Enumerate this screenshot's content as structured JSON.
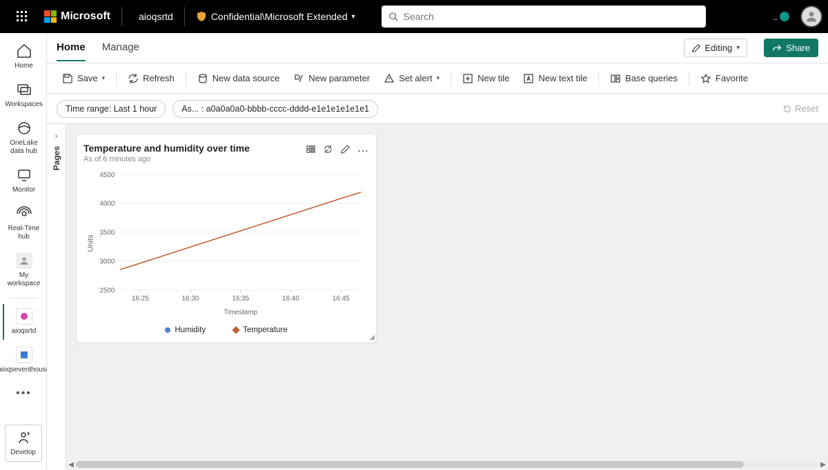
{
  "header": {
    "brand": "Microsoft",
    "tenant": "aioqsrtd",
    "sensitivity_label": "Confidential\\Microsoft Extended",
    "search_placeholder": "Search"
  },
  "leftnav": {
    "home": "Home",
    "workspaces": "Workspaces",
    "onelake": "OneLake data hub",
    "monitor": "Monitor",
    "realtime": "Real-Time hub",
    "myworkspace": "My workspace",
    "item1": "aioqsrtd",
    "item2": "aioqseventhouse",
    "develop": "Develop"
  },
  "tabs": {
    "home": "Home",
    "manage": "Manage",
    "editing": "Editing",
    "share": "Share"
  },
  "toolbar": {
    "save": "Save",
    "refresh": "Refresh",
    "new_data_source": "New data source",
    "new_parameter": "New parameter",
    "set_alert": "Set alert",
    "new_tile": "New tile",
    "new_text_tile": "New text tile",
    "base_queries": "Base queries",
    "favorite": "Favorite"
  },
  "filters": {
    "time_range": "Time range: Last 1 hour",
    "param": "As... : a0a0a0a0-bbbb-cccc-dddd-e1e1e1e1e1e1",
    "reset": "Reset"
  },
  "pages_label": "Pages",
  "tile": {
    "title": "Temperature and humidity over time",
    "subtitle": "As of 6 minutes ago",
    "ylabel": "Units",
    "xlabel": "Timestamp",
    "legend_humidity": "Humidity",
    "legend_temperature": "Temperature"
  },
  "colors": {
    "accent": "#117865",
    "temperature": "#c05f34",
    "humidity": "#4a7ed9"
  },
  "chart_data": {
    "type": "line",
    "title": "Temperature and humidity over time",
    "xlabel": "Timestamp",
    "ylabel": "Units",
    "x_ticks": [
      "16:25",
      "16:30",
      "16:35",
      "16:40",
      "16:45"
    ],
    "y_ticks": [
      2500,
      3000,
      3500,
      4000,
      4500
    ],
    "ylim": [
      2500,
      4500
    ],
    "series": [
      {
        "name": "Temperature",
        "color": "#c05f34",
        "x": [
          "16:23",
          "16:25",
          "16:30",
          "16:35",
          "16:40",
          "16:45",
          "16:47"
        ],
        "values": [
          2850,
          2960,
          3240,
          3520,
          3800,
          4080,
          4190
        ]
      },
      {
        "name": "Humidity",
        "color": "#4a7ed9",
        "x": [],
        "values": []
      }
    ]
  }
}
